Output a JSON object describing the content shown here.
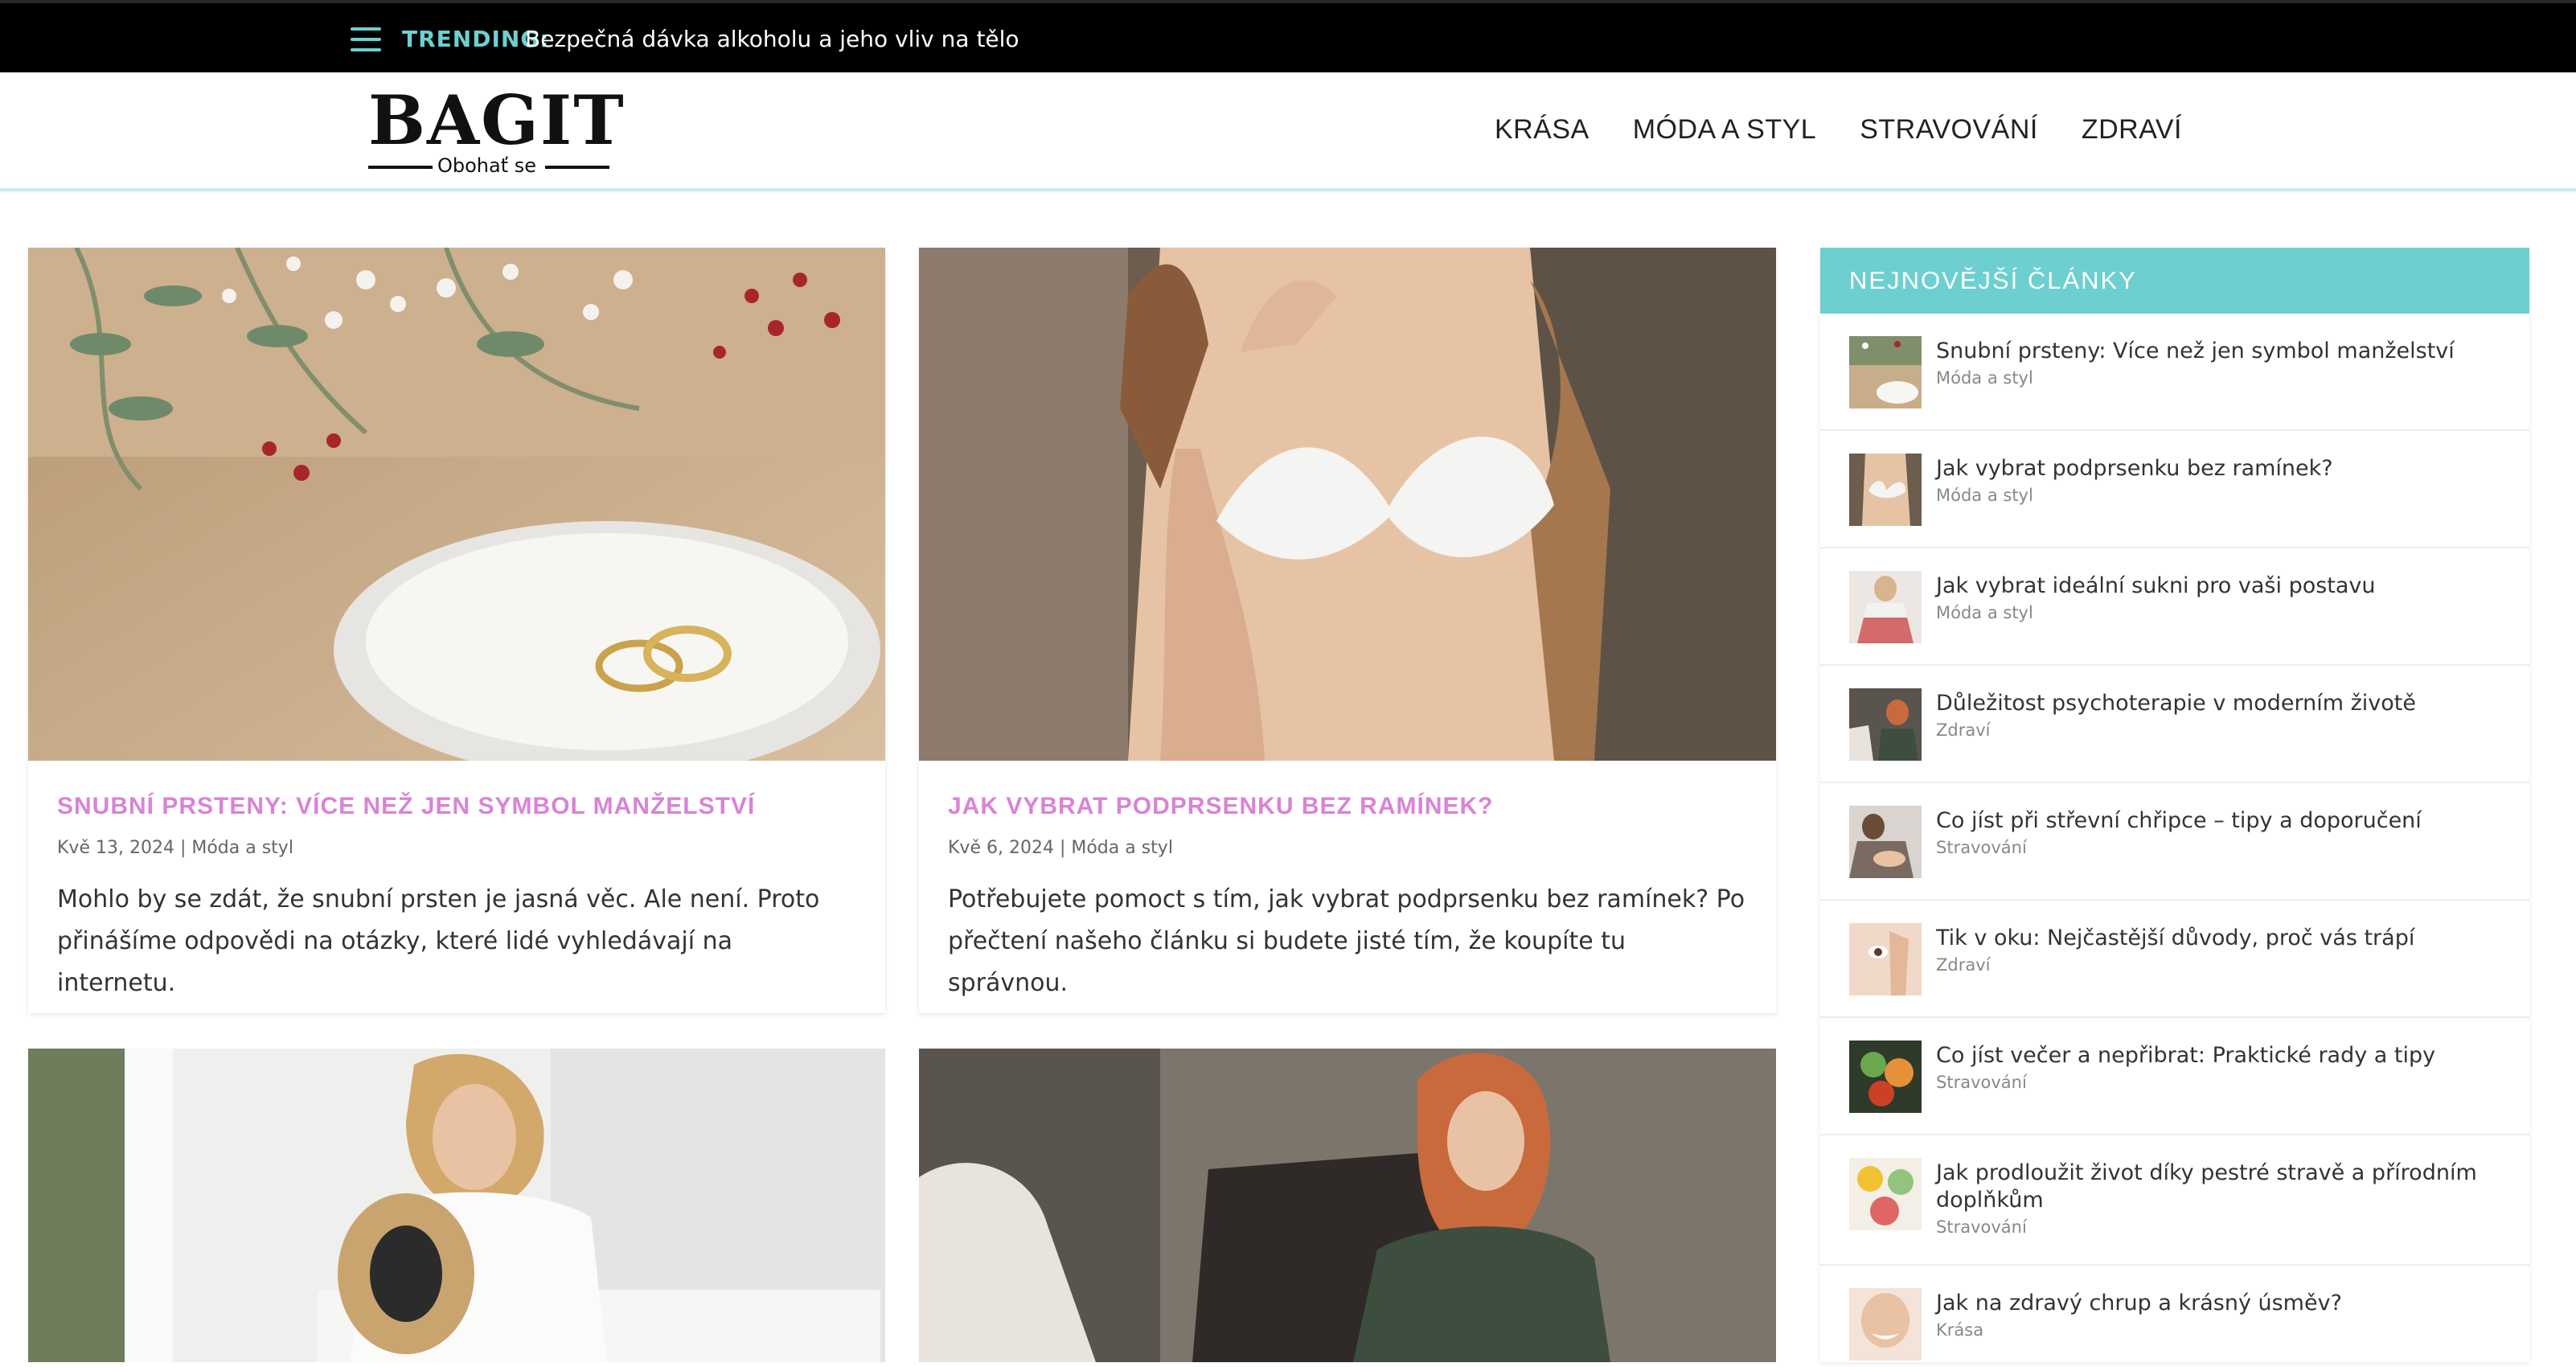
{
  "topbar": {
    "trending_label": "TRENDING:",
    "trending_text": "Bezpečná dávka alkoholu a jeho vliv na tělo"
  },
  "header": {
    "logo_text": "BAGIT",
    "logo_sub": "Obohať se",
    "nav": [
      "KRÁSA",
      "MÓDA A STYL",
      "STRAVOVÁNÍ",
      "ZDRAVÍ"
    ]
  },
  "posts": [
    {
      "title": "SNUBNÍ PRSTENY: VÍCE NEŽ JEN SYMBOL MANŽELSTVÍ",
      "date": "Kvě 13, 2024",
      "category": "Móda a styl",
      "excerpt": "Mohlo by se zdát, že snubní prsten je jasná věc. Ale není. Proto přinášíme odpovědi na otázky, které lidé vyhledávají na internetu."
    },
    {
      "title": "JAK VYBRAT PODPRSENKU BEZ RAMÍNEK?",
      "date": "Kvě 6, 2024",
      "category": "Móda a styl",
      "excerpt": "Potřebujete pomoct s tím, jak vybrat podprsenku bez ramínek? Po přečtení našeho článku si budete jisté tím, že koupíte tu správnou."
    }
  ],
  "sidebar": {
    "heading": "NEJNOVĚJŠÍ ČLÁNKY",
    "items": [
      {
        "title": "Snubní prsteny: Více než jen symbol manželství",
        "category": "Móda a styl"
      },
      {
        "title": "Jak vybrat podprsenku bez ramínek?",
        "category": "Móda a styl"
      },
      {
        "title": "Jak vybrat ideální sukni pro vaši postavu",
        "category": "Móda a styl"
      },
      {
        "title": "Důležitost psychoterapie v moderním životě",
        "category": "Zdraví"
      },
      {
        "title": "Co jíst při střevní chřipce – tipy a doporučení",
        "category": "Stravování"
      },
      {
        "title": "Tik v oku: Nejčastější důvody, proč vás trápí",
        "category": "Zdraví"
      },
      {
        "title": "Co jíst večer a nepřibrat: Praktické rady a tipy",
        "category": "Stravování"
      },
      {
        "title": "Jak prodloužit život díky pestré stravě a přírodním doplňkům",
        "category": "Stravování"
      },
      {
        "title": "Jak na zdravý chrup a krásný úsměv?",
        "category": "Krása"
      }
    ]
  },
  "colors": {
    "accent": "#6dcfd0",
    "post_title": "#d983d6",
    "topbar_bg": "#000000"
  }
}
